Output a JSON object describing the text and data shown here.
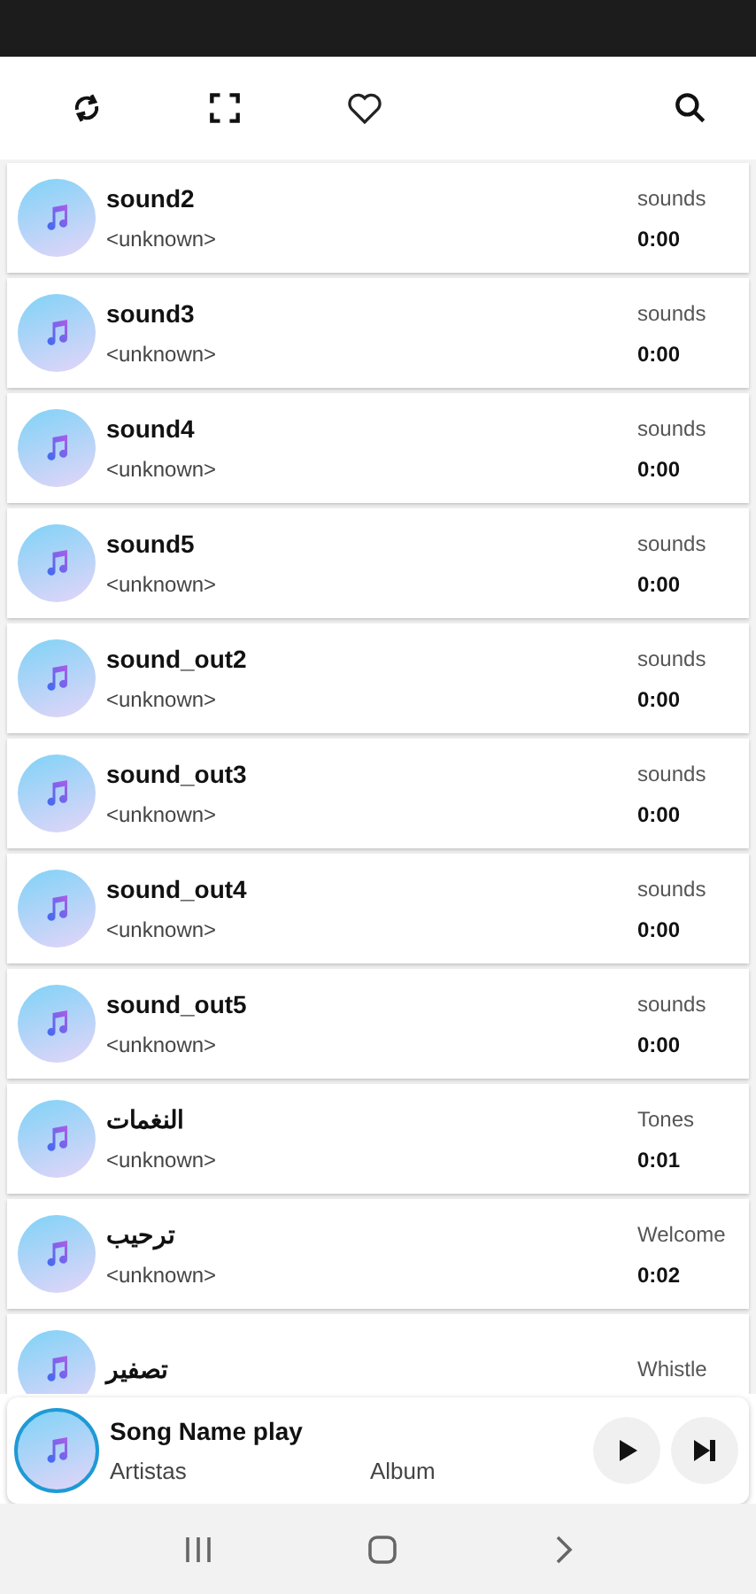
{
  "songs": [
    {
      "title": "sound2",
      "artist": "<unknown>",
      "album": "sounds",
      "duration": "0:00"
    },
    {
      "title": "sound3",
      "artist": "<unknown>",
      "album": "sounds",
      "duration": "0:00"
    },
    {
      "title": "sound4",
      "artist": "<unknown>",
      "album": "sounds",
      "duration": "0:00"
    },
    {
      "title": "sound5",
      "artist": "<unknown>",
      "album": "sounds",
      "duration": "0:00"
    },
    {
      "title": "sound_out2",
      "artist": "<unknown>",
      "album": "sounds",
      "duration": "0:00"
    },
    {
      "title": "sound_out3",
      "artist": "<unknown>",
      "album": "sounds",
      "duration": "0:00"
    },
    {
      "title": "sound_out4",
      "artist": "<unknown>",
      "album": "sounds",
      "duration": "0:00"
    },
    {
      "title": "sound_out5",
      "artist": "<unknown>",
      "album": "sounds",
      "duration": "0:00"
    },
    {
      "title": "النغمات",
      "artist": "<unknown>",
      "album": "Tones",
      "duration": "0:01"
    },
    {
      "title": "ترحيب",
      "artist": "<unknown>",
      "album": "Welcome",
      "duration": "0:02"
    },
    {
      "title": "تصفير",
      "album": "Whistle"
    }
  ],
  "player": {
    "title": "Song Name play",
    "artist": "Artistas",
    "album": "Album"
  }
}
